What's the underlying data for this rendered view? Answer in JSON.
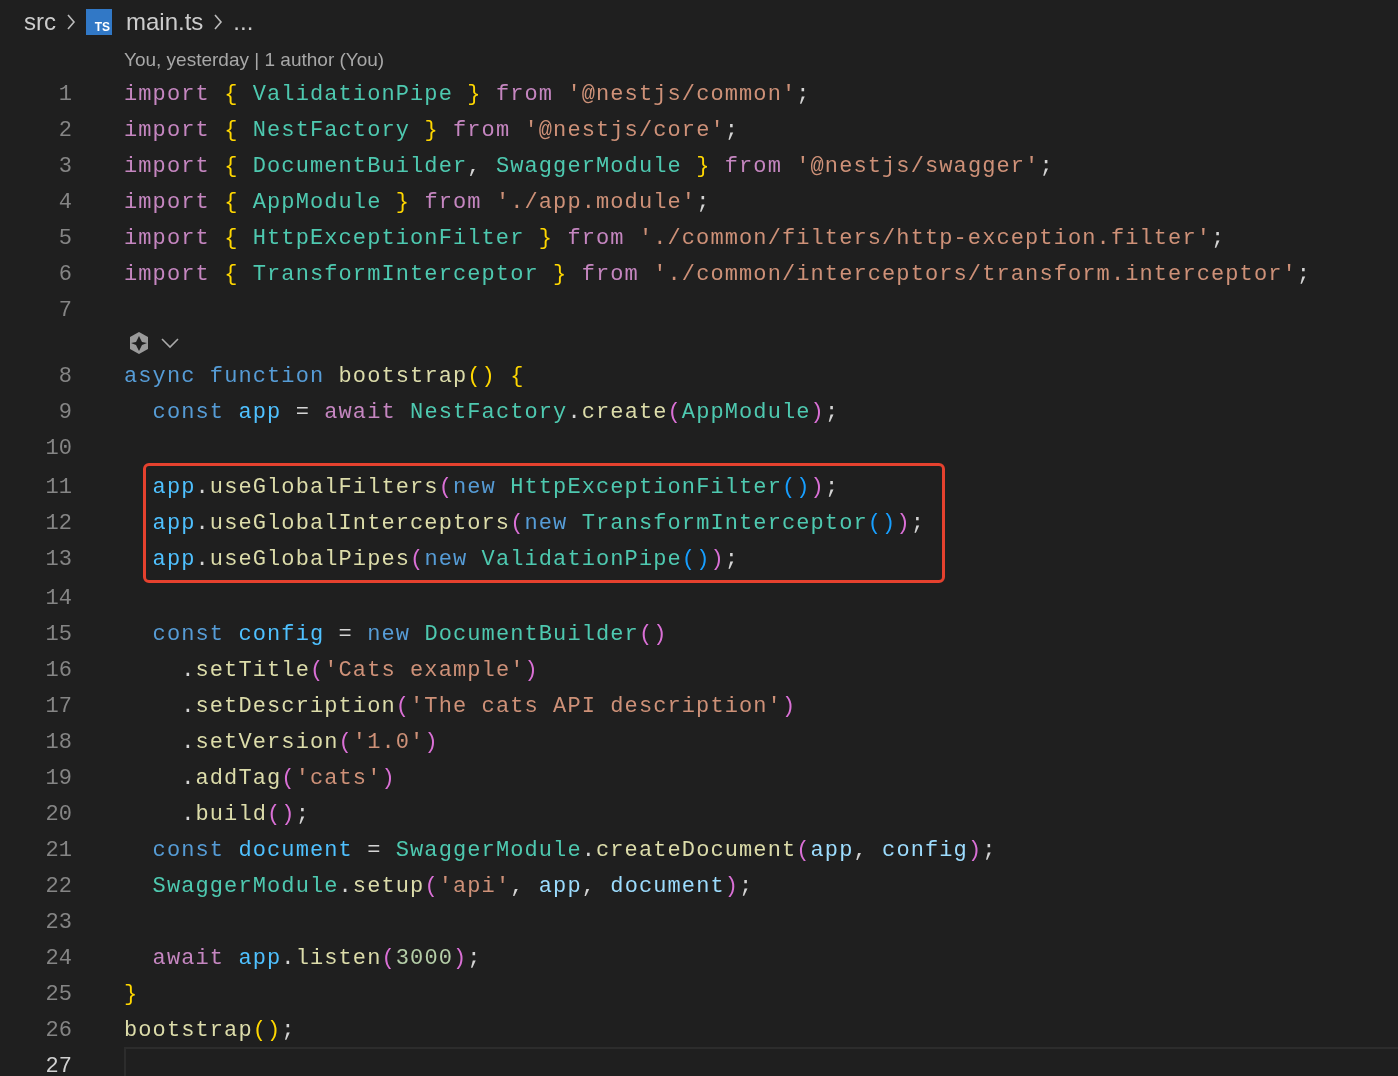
{
  "breadcrumb": {
    "items": [
      {
        "text": "src",
        "kind": "folder"
      },
      {
        "text": "main.ts",
        "kind": "file",
        "badge": "TS"
      }
    ],
    "more": "..."
  },
  "blame": "You, yesterday | 1 author (You)",
  "lines": [
    {
      "kind": "code",
      "number": "1",
      "current": false,
      "boxed": false,
      "tokens": [
        {
          "text": "import ",
          "kind": "kw2"
        },
        {
          "text": "{ ",
          "kind": "b1"
        },
        {
          "text": "ValidationPipe ",
          "kind": "cls"
        },
        {
          "text": "} ",
          "kind": "b1"
        },
        {
          "text": "from ",
          "kind": "kw2"
        },
        {
          "text": "'@nestjs/common'",
          "kind": "str"
        },
        {
          "text": ";",
          "kind": "p"
        }
      ]
    },
    {
      "kind": "code",
      "number": "2",
      "current": false,
      "boxed": false,
      "tokens": [
        {
          "text": "import ",
          "kind": "kw2"
        },
        {
          "text": "{ ",
          "kind": "b1"
        },
        {
          "text": "NestFactory ",
          "kind": "cls"
        },
        {
          "text": "} ",
          "kind": "b1"
        },
        {
          "text": "from ",
          "kind": "kw2"
        },
        {
          "text": "'@nestjs/core'",
          "kind": "str"
        },
        {
          "text": ";",
          "kind": "p"
        }
      ]
    },
    {
      "kind": "code",
      "number": "3",
      "current": false,
      "boxed": false,
      "tokens": [
        {
          "text": "import ",
          "kind": "kw2"
        },
        {
          "text": "{ ",
          "kind": "b1"
        },
        {
          "text": "DocumentBuilder",
          "kind": "cls"
        },
        {
          "text": ", ",
          "kind": "p"
        },
        {
          "text": "SwaggerModule ",
          "kind": "cls"
        },
        {
          "text": "} ",
          "kind": "b1"
        },
        {
          "text": "from ",
          "kind": "kw2"
        },
        {
          "text": "'@nestjs/swagger'",
          "kind": "str"
        },
        {
          "text": ";",
          "kind": "p"
        }
      ]
    },
    {
      "kind": "code",
      "number": "4",
      "current": false,
      "boxed": false,
      "tokens": [
        {
          "text": "import ",
          "kind": "kw2"
        },
        {
          "text": "{ ",
          "kind": "b1"
        },
        {
          "text": "AppModule ",
          "kind": "cls"
        },
        {
          "text": "} ",
          "kind": "b1"
        },
        {
          "text": "from ",
          "kind": "kw2"
        },
        {
          "text": "'./app.module'",
          "kind": "str"
        },
        {
          "text": ";",
          "kind": "p"
        }
      ]
    },
    {
      "kind": "code",
      "number": "5",
      "current": false,
      "boxed": false,
      "tokens": [
        {
          "text": "import ",
          "kind": "kw2"
        },
        {
          "text": "{ ",
          "kind": "b1"
        },
        {
          "text": "HttpExceptionFilter ",
          "kind": "cls"
        },
        {
          "text": "} ",
          "kind": "b1"
        },
        {
          "text": "from ",
          "kind": "kw2"
        },
        {
          "text": "'./common/filters/http-exception.filter'",
          "kind": "str"
        },
        {
          "text": ";",
          "kind": "p"
        }
      ]
    },
    {
      "kind": "code",
      "number": "6",
      "current": false,
      "boxed": false,
      "tokens": [
        {
          "text": "import ",
          "kind": "kw2"
        },
        {
          "text": "{ ",
          "kind": "b1"
        },
        {
          "text": "TransformInterceptor ",
          "kind": "cls"
        },
        {
          "text": "} ",
          "kind": "b1"
        },
        {
          "text": "from ",
          "kind": "kw2"
        },
        {
          "text": "'./common/interceptors/transform.interceptor'",
          "kind": "str"
        },
        {
          "text": ";",
          "kind": "p"
        }
      ]
    },
    {
      "kind": "code",
      "number": "7",
      "current": false,
      "boxed": false
    },
    {
      "kind": "codelens"
    },
    {
      "kind": "code",
      "number": "8",
      "current": false,
      "boxed": false,
      "tokens": [
        {
          "text": "async ",
          "kind": "kw"
        },
        {
          "text": "function ",
          "kind": "kw"
        },
        {
          "text": "bootstrap",
          "kind": "fn"
        },
        {
          "text": "() ",
          "kind": "b1"
        },
        {
          "text": "{",
          "kind": "b1"
        }
      ]
    },
    {
      "kind": "code",
      "number": "9",
      "current": false,
      "boxed": false,
      "tokens": [
        {
          "text": "  const ",
          "kind": "kw"
        },
        {
          "text": "app ",
          "kind": "con"
        },
        {
          "text": "= ",
          "kind": "p"
        },
        {
          "text": "await ",
          "kind": "kw2"
        },
        {
          "text": "NestFactory",
          "kind": "cls"
        },
        {
          "text": ".",
          "kind": "p"
        },
        {
          "text": "create",
          "kind": "fn"
        },
        {
          "text": "(",
          "kind": "b2"
        },
        {
          "text": "AppModule",
          "kind": "cls"
        },
        {
          "text": ")",
          "kind": "b2"
        },
        {
          "text": ";",
          "kind": "p"
        }
      ]
    },
    {
      "kind": "code",
      "number": "10",
      "current": false,
      "boxed": false
    },
    {
      "kind": "code",
      "number": "11",
      "current": false,
      "boxed": true,
      "tokens": [
        {
          "text": "  app",
          "kind": "con"
        },
        {
          "text": ".",
          "kind": "p"
        },
        {
          "text": "useGlobalFilters",
          "kind": "fn"
        },
        {
          "text": "(",
          "kind": "b2"
        },
        {
          "text": "new ",
          "kind": "kw"
        },
        {
          "text": "HttpExceptionFilter",
          "kind": "cls"
        },
        {
          "text": "()",
          "kind": "b3"
        },
        {
          "text": ")",
          "kind": "b2"
        },
        {
          "text": ";",
          "kind": "p"
        }
      ]
    },
    {
      "kind": "code",
      "number": "12",
      "current": false,
      "boxed": true,
      "tokens": [
        {
          "text": "  app",
          "kind": "con"
        },
        {
          "text": ".",
          "kind": "p"
        },
        {
          "text": "useGlobalInterceptors",
          "kind": "fn"
        },
        {
          "text": "(",
          "kind": "b2"
        },
        {
          "text": "new ",
          "kind": "kw"
        },
        {
          "text": "TransformInterceptor",
          "kind": "cls"
        },
        {
          "text": "()",
          "kind": "b3"
        },
        {
          "text": ")",
          "kind": "b2"
        },
        {
          "text": ";",
          "kind": "p"
        }
      ]
    },
    {
      "kind": "code",
      "number": "13",
      "current": false,
      "boxed": true,
      "tokens": [
        {
          "text": "  app",
          "kind": "con"
        },
        {
          "text": ".",
          "kind": "p"
        },
        {
          "text": "useGlobalPipes",
          "kind": "fn"
        },
        {
          "text": "(",
          "kind": "b2"
        },
        {
          "text": "new ",
          "kind": "kw"
        },
        {
          "text": "ValidationPipe",
          "kind": "cls"
        },
        {
          "text": "()",
          "kind": "b3"
        },
        {
          "text": ")",
          "kind": "b2"
        },
        {
          "text": ";",
          "kind": "p"
        }
      ]
    },
    {
      "kind": "code",
      "number": "14",
      "current": false,
      "boxed": false
    },
    {
      "kind": "code",
      "number": "15",
      "current": false,
      "boxed": false,
      "tokens": [
        {
          "text": "  const ",
          "kind": "kw"
        },
        {
          "text": "config ",
          "kind": "con"
        },
        {
          "text": "= ",
          "kind": "p"
        },
        {
          "text": "new ",
          "kind": "kw"
        },
        {
          "text": "DocumentBuilder",
          "kind": "cls"
        },
        {
          "text": "()",
          "kind": "b2"
        }
      ]
    },
    {
      "kind": "code",
      "number": "16",
      "current": false,
      "boxed": false,
      "tokens": [
        {
          "text": "    .",
          "kind": "p"
        },
        {
          "text": "setTitle",
          "kind": "fn"
        },
        {
          "text": "(",
          "kind": "b2"
        },
        {
          "text": "'Cats example'",
          "kind": "str"
        },
        {
          "text": ")",
          "kind": "b2"
        }
      ]
    },
    {
      "kind": "code",
      "number": "17",
      "current": false,
      "boxed": false,
      "tokens": [
        {
          "text": "    .",
          "kind": "p"
        },
        {
          "text": "setDescription",
          "kind": "fn"
        },
        {
          "text": "(",
          "kind": "b2"
        },
        {
          "text": "'The cats API description'",
          "kind": "str"
        },
        {
          "text": ")",
          "kind": "b2"
        }
      ]
    },
    {
      "kind": "code",
      "number": "18",
      "current": false,
      "boxed": false,
      "tokens": [
        {
          "text": "    .",
          "kind": "p"
        },
        {
          "text": "setVersion",
          "kind": "fn"
        },
        {
          "text": "(",
          "kind": "b2"
        },
        {
          "text": "'1.0'",
          "kind": "str"
        },
        {
          "text": ")",
          "kind": "b2"
        }
      ]
    },
    {
      "kind": "code",
      "number": "19",
      "current": false,
      "boxed": false,
      "tokens": [
        {
          "text": "    .",
          "kind": "p"
        },
        {
          "text": "addTag",
          "kind": "fn"
        },
        {
          "text": "(",
          "kind": "b2"
        },
        {
          "text": "'cats'",
          "kind": "str"
        },
        {
          "text": ")",
          "kind": "b2"
        }
      ]
    },
    {
      "kind": "code",
      "number": "20",
      "current": false,
      "boxed": false,
      "tokens": [
        {
          "text": "    .",
          "kind": "p"
        },
        {
          "text": "build",
          "kind": "fn"
        },
        {
          "text": "()",
          "kind": "b2"
        },
        {
          "text": ";",
          "kind": "p"
        }
      ]
    },
    {
      "kind": "code",
      "number": "21",
      "current": false,
      "boxed": false,
      "tokens": [
        {
          "text": "  const ",
          "kind": "kw"
        },
        {
          "text": "document ",
          "kind": "con"
        },
        {
          "text": "= ",
          "kind": "p"
        },
        {
          "text": "SwaggerModule",
          "kind": "cls"
        },
        {
          "text": ".",
          "kind": "p"
        },
        {
          "text": "createDocument",
          "kind": "fn"
        },
        {
          "text": "(",
          "kind": "b2"
        },
        {
          "text": "app",
          "kind": "var"
        },
        {
          "text": ", ",
          "kind": "p"
        },
        {
          "text": "config",
          "kind": "var"
        },
        {
          "text": ")",
          "kind": "b2"
        },
        {
          "text": ";",
          "kind": "p"
        }
      ]
    },
    {
      "kind": "code",
      "number": "22",
      "current": false,
      "boxed": false,
      "tokens": [
        {
          "text": "  SwaggerModule",
          "kind": "cls"
        },
        {
          "text": ".",
          "kind": "p"
        },
        {
          "text": "setup",
          "kind": "fn"
        },
        {
          "text": "(",
          "kind": "b2"
        },
        {
          "text": "'api'",
          "kind": "str"
        },
        {
          "text": ", ",
          "kind": "p"
        },
        {
          "text": "app",
          "kind": "var"
        },
        {
          "text": ", ",
          "kind": "p"
        },
        {
          "text": "document",
          "kind": "var"
        },
        {
          "text": ")",
          "kind": "b2"
        },
        {
          "text": ";",
          "kind": "p"
        }
      ]
    },
    {
      "kind": "code",
      "number": "23",
      "current": false,
      "boxed": false
    },
    {
      "kind": "code",
      "number": "24",
      "current": false,
      "boxed": false,
      "tokens": [
        {
          "text": "  await ",
          "kind": "kw2"
        },
        {
          "text": "app",
          "kind": "con"
        },
        {
          "text": ".",
          "kind": "p"
        },
        {
          "text": "listen",
          "kind": "fn"
        },
        {
          "text": "(",
          "kind": "b2"
        },
        {
          "text": "3000",
          "kind": "num"
        },
        {
          "text": ")",
          "kind": "b2"
        },
        {
          "text": ";",
          "kind": "p"
        }
      ]
    },
    {
      "kind": "code",
      "number": "25",
      "current": false,
      "boxed": false,
      "tokens": [
        {
          "text": "}",
          "kind": "b1"
        }
      ]
    },
    {
      "kind": "code",
      "number": "26",
      "current": false,
      "boxed": false,
      "tokens": [
        {
          "text": "bootstrap",
          "kind": "fn"
        },
        {
          "text": "()",
          "kind": "b1"
        },
        {
          "text": ";",
          "kind": "p"
        }
      ]
    },
    {
      "kind": "code",
      "number": "27",
      "current": true,
      "boxed": false
    }
  ]
}
